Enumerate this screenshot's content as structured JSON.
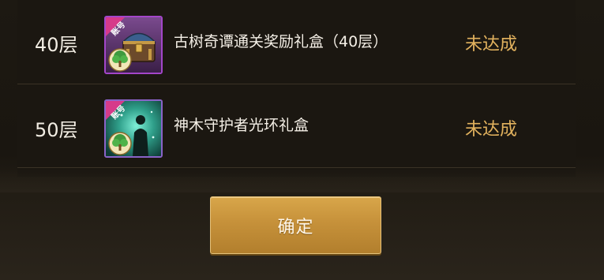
{
  "rows": [
    {
      "level": "40层",
      "badge": "账号",
      "icon": "treasure-chest-icon",
      "reward": "古树奇谭通关奖励礼盒（40层）",
      "status": "未达成"
    },
    {
      "level": "50层",
      "badge": "账号",
      "icon": "guardian-aura-icon",
      "reward": "神木守护者光环礼盒",
      "status": "未达成"
    }
  ],
  "confirm_label": "确定",
  "colors": {
    "status": "#e2b25e",
    "button": "#c6913a",
    "frame_purple": "#a346c9",
    "ribbon": "#d63a8a"
  }
}
